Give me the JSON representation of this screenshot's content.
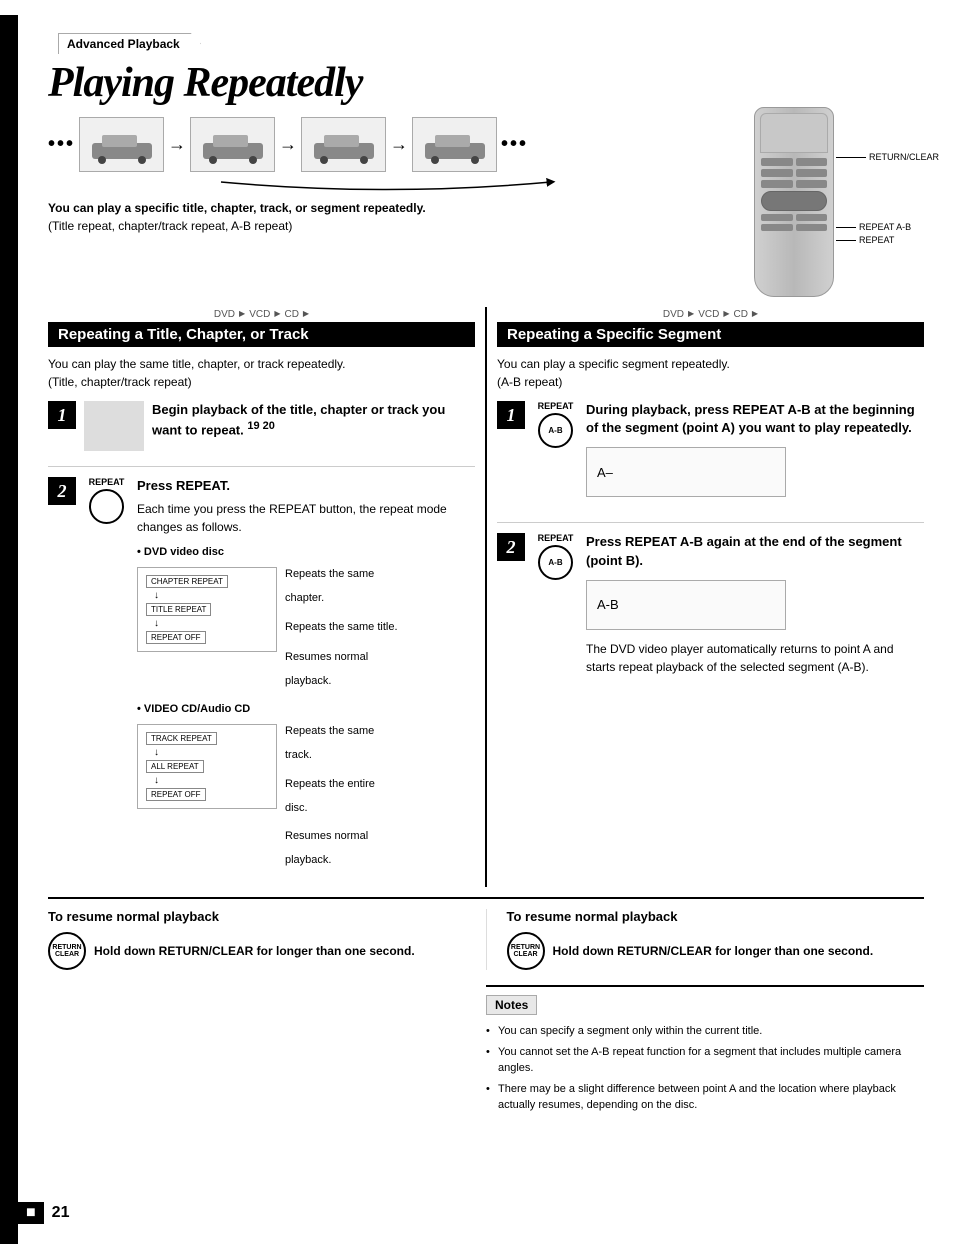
{
  "breadcrumb": "Advanced Playback",
  "page_title": "Playing Repeatedly",
  "caption_bold": "You can play a specific title, chapter, track, or segment repeatedly.",
  "caption_paren": "(Title repeat, chapter/track repeat, A-B repeat)",
  "remote_labels": {
    "return_clear": "RETURN/CLEAR",
    "repeat_ab": "REPEAT A-B",
    "repeat": "REPEAT"
  },
  "left_section": {
    "format_bar": "DVD   VCD   CD",
    "header": "Repeating a Title, Chapter, or Track",
    "desc_line1": "You can play the same title, chapter, or track repeatedly.",
    "desc_line2": "(Title, chapter/track repeat)",
    "step1": {
      "num": "1",
      "text": "Begin playback of the title, chapter or track you want to repeat.",
      "refs": "19  20"
    },
    "step2": {
      "num": "2",
      "icon_label": "REPEAT",
      "title": "Press REPEAT.",
      "desc1": "Each time you press the REPEAT button, the repeat mode changes as follows.",
      "dvd_label": "DVD video disc",
      "dvd_modes": [
        {
          "box": "CHAPTER REPEAT",
          "desc": "Repeats the same chapter."
        },
        {
          "box": "TITLE REPEAT",
          "desc": "Repeats the same title."
        },
        {
          "box": "REPEAT OFF",
          "desc": "Resumes normal playback."
        }
      ],
      "vcd_label": "VIDEO CD/Audio CD",
      "vcd_modes": [
        {
          "box": "TRACK REPEAT",
          "desc": "Repeats the same track."
        },
        {
          "box": "ALL REPEAT",
          "desc": "Repeats the entire disc."
        },
        {
          "box": "REPEAT OFF",
          "desc": "Resumes normal playback."
        }
      ]
    }
  },
  "right_section": {
    "format_bar": "DVD   VCD   CD",
    "header": "Repeating a Specific Segment",
    "desc_line1": "You can play a specific segment repeatedly.",
    "desc_line2": "(A-B repeat)",
    "step1": {
      "num": "1",
      "icon_label": "REPEAT",
      "icon_sub": "A-B",
      "title": "During playback, press REPEAT A-B at the beginning of the segment (point A) you want to play repeatedly.",
      "display": "A–"
    },
    "step2": {
      "num": "2",
      "icon_label": "REPEAT",
      "icon_sub": "A-B",
      "title": "Press REPEAT A-B again at the end of the segment (point B).",
      "display": "A-B"
    },
    "auto_desc": "The DVD video player automatically returns to point A and starts repeat playback of the selected segment (A-B)."
  },
  "bottom": {
    "left": {
      "title": "To resume normal playback",
      "icon_top": "RETURN",
      "icon_bottom": "CLEAR",
      "text": "Hold down RETURN/CLEAR for longer than one second."
    },
    "right": {
      "title": "To resume normal playback",
      "icon_top": "RETURN",
      "icon_bottom": "CLEAR",
      "text": "Hold down RETURN/CLEAR for longer than one second."
    }
  },
  "notes": {
    "header": "Notes",
    "items": [
      "You can specify a segment only within the current title.",
      "You cannot set the A-B repeat function for a segment that includes multiple camera angles.",
      "There may be a slight difference between point A and the location where playback actually resumes, depending on the disc."
    ]
  },
  "page_number": "21"
}
